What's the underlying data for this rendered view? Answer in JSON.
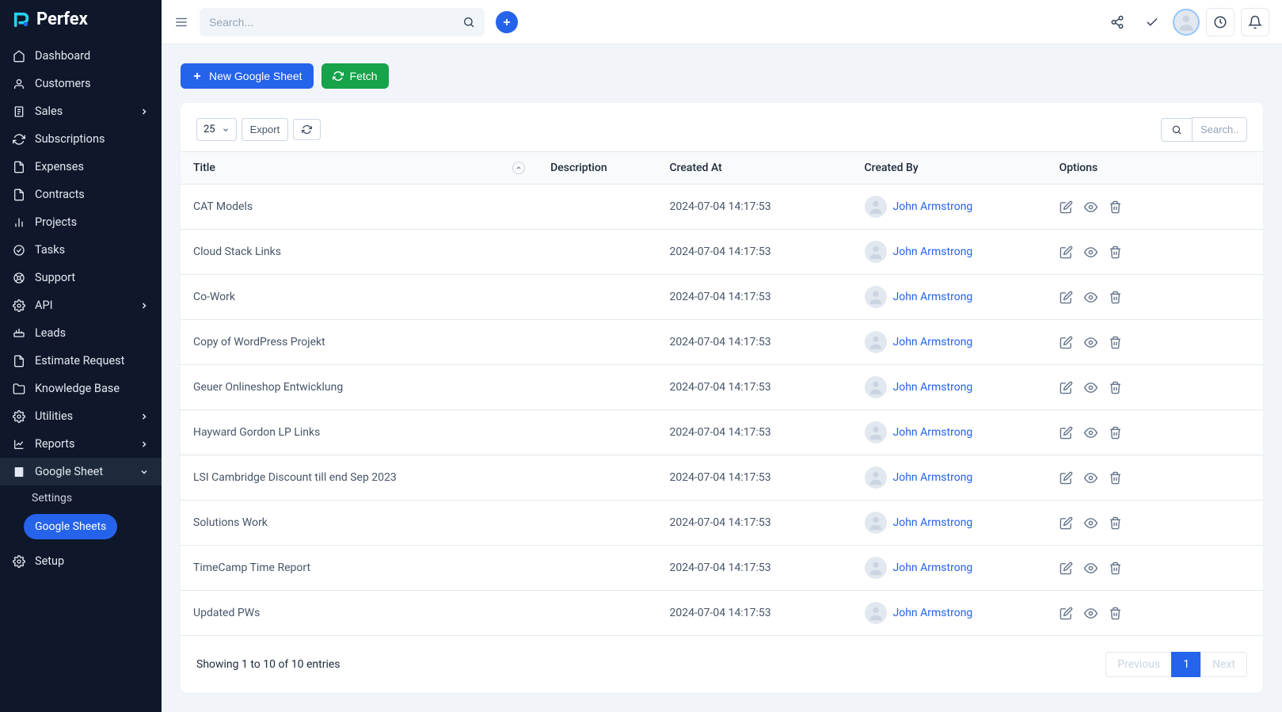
{
  "brand": "Perfex",
  "header": {
    "search_placeholder": "Search..."
  },
  "sidebar": {
    "items": [
      {
        "label": "Dashboard"
      },
      {
        "label": "Customers"
      },
      {
        "label": "Sales",
        "caret": true
      },
      {
        "label": "Subscriptions"
      },
      {
        "label": "Expenses"
      },
      {
        "label": "Contracts"
      },
      {
        "label": "Projects"
      },
      {
        "label": "Tasks"
      },
      {
        "label": "Support"
      },
      {
        "label": "API",
        "caret": true
      },
      {
        "label": "Leads"
      },
      {
        "label": "Estimate Request"
      },
      {
        "label": "Knowledge Base"
      },
      {
        "label": "Utilities",
        "caret": true
      },
      {
        "label": "Reports",
        "caret": true
      },
      {
        "label": "Google Sheet",
        "caret": true,
        "active": true
      }
    ],
    "sub_settings": "Settings",
    "sub_google_sheets": "Google Sheets",
    "setup": "Setup"
  },
  "actions": {
    "new_sheet": "New Google Sheet",
    "fetch": "Fetch"
  },
  "toolbar": {
    "page_size": "25",
    "export": "Export",
    "search_placeholder": "Search.."
  },
  "table": {
    "headers": {
      "title": "Title",
      "description": "Description",
      "created_at": "Created At",
      "created_by": "Created By",
      "options": "Options"
    },
    "rows": [
      {
        "title": "CAT Models",
        "description": "",
        "created_at": "2024-07-04 14:17:53",
        "created_by": "John Armstrong"
      },
      {
        "title": "Cloud Stack Links",
        "description": "",
        "created_at": "2024-07-04 14:17:53",
        "created_by": "John Armstrong"
      },
      {
        "title": "Co-Work",
        "description": "",
        "created_at": "2024-07-04 14:17:53",
        "created_by": "John Armstrong"
      },
      {
        "title": "Copy of WordPress Projekt",
        "description": "",
        "created_at": "2024-07-04 14:17:53",
        "created_by": "John Armstrong"
      },
      {
        "title": "Geuer Onlineshop Entwicklung",
        "description": "",
        "created_at": "2024-07-04 14:17:53",
        "created_by": "John Armstrong"
      },
      {
        "title": "Hayward Gordon LP Links",
        "description": "",
        "created_at": "2024-07-04 14:17:53",
        "created_by": "John Armstrong"
      },
      {
        "title": "LSI Cambridge Discount till end Sep 2023",
        "description": "",
        "created_at": "2024-07-04 14:17:53",
        "created_by": "John Armstrong"
      },
      {
        "title": "Solutions Work",
        "description": "",
        "created_at": "2024-07-04 14:17:53",
        "created_by": "John Armstrong"
      },
      {
        "title": "TimeCamp Time Report",
        "description": "",
        "created_at": "2024-07-04 14:17:53",
        "created_by": "John Armstrong"
      },
      {
        "title": "Updated PWs",
        "description": "",
        "created_at": "2024-07-04 14:17:53",
        "created_by": "John Armstrong"
      }
    ],
    "footer_info": "Showing 1 to 10 of 10 entries",
    "pagination": {
      "previous": "Previous",
      "page1": "1",
      "next": "Next"
    }
  }
}
